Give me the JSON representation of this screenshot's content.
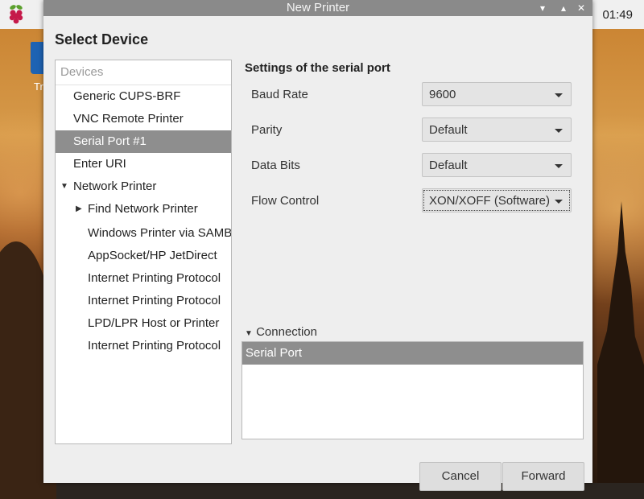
{
  "desktop": {
    "trash_label": "Tr"
  },
  "taskbar": {
    "clock": "01:49"
  },
  "window": {
    "title": "New Printer",
    "controls": [
      "▾",
      "▴",
      "✕"
    ]
  },
  "dialog": {
    "heading": "Select Device",
    "device_list": {
      "header": "Devices",
      "items": [
        {
          "label": "Generic CUPS-BRF",
          "level": 0,
          "selected": false
        },
        {
          "label": "VNC Remote Printer",
          "level": 0,
          "selected": false
        },
        {
          "label": "Serial Port #1",
          "level": 0,
          "selected": true
        },
        {
          "label": "Enter URI",
          "level": 0,
          "selected": false
        },
        {
          "label": "Network Printer",
          "level": 0,
          "expander": "expanded"
        },
        {
          "label": "Find Network Printer",
          "level": 1,
          "expander": "collapsed"
        },
        {
          "label": "Windows Printer via SAMBA",
          "level": 1
        },
        {
          "label": "AppSocket/HP JetDirect",
          "level": 1
        },
        {
          "label": "Internet Printing Protocol",
          "level": 1
        },
        {
          "label": "Internet Printing Protocol",
          "level": 1
        },
        {
          "label": "LPD/LPR Host or Printer",
          "level": 1
        },
        {
          "label": "Internet Printing Protocol",
          "level": 1
        }
      ]
    },
    "settings": {
      "title": "Settings of the serial port",
      "baud_rate": {
        "label": "Baud Rate",
        "value": "9600"
      },
      "parity": {
        "label": "Parity",
        "value": "Default"
      },
      "data_bits": {
        "label": "Data Bits",
        "value": "Default"
      },
      "flow_control": {
        "label": "Flow Control",
        "value": "XON/XOFF (Software)"
      }
    },
    "connection": {
      "label": "Connection",
      "items": [
        "Serial Port"
      ]
    },
    "buttons": {
      "cancel": "Cancel",
      "forward": "Forward"
    }
  }
}
